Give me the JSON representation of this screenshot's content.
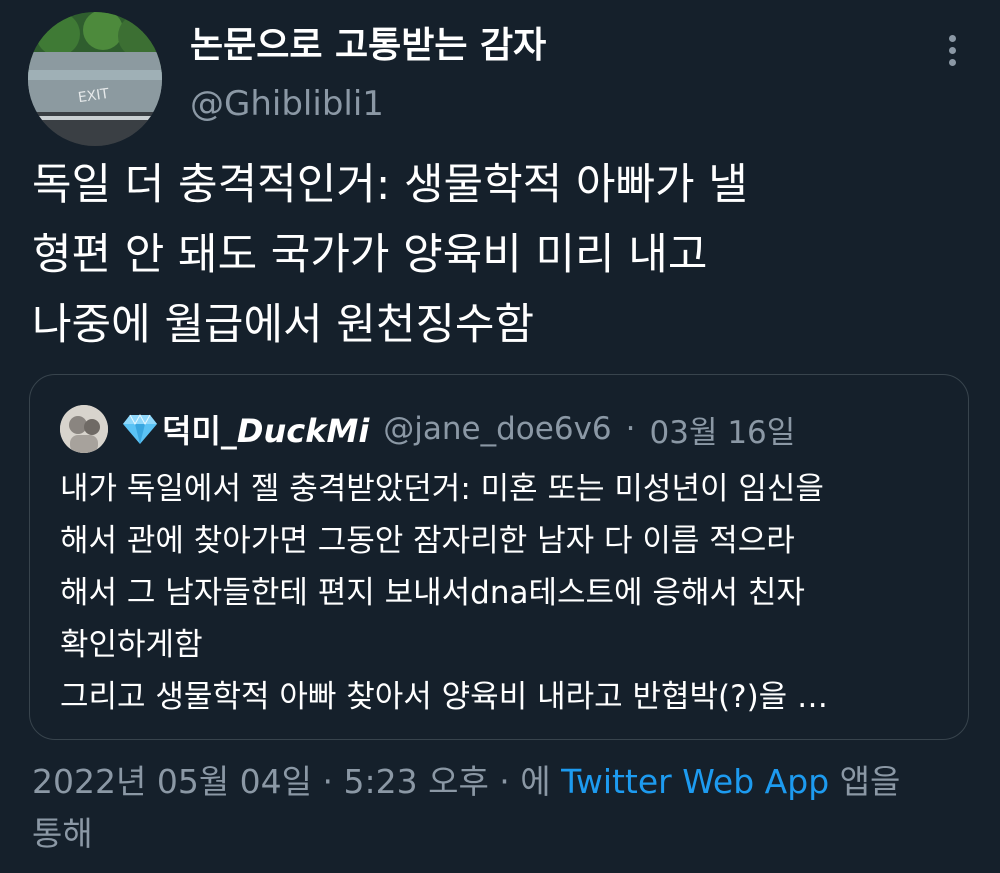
{
  "author": {
    "display_name": "논문으로 고통받는 감자",
    "handle": "@Ghiblibli1",
    "avatar_text": "EXIT"
  },
  "tweet": {
    "lines": [
      "독일 더 충격적인거: 생물학적 아빠가 낼",
      "형편 안 돼도 국가가 양육비 미리 내고",
      "나중에 월급에서 원천징수함"
    ]
  },
  "quoted": {
    "name_korean": "덕미_",
    "name_latin": "DuckMi",
    "handle": "@jane_doe6v6",
    "separator": "·",
    "date": "03월 16일",
    "lines": [
      "내가 독일에서 젤 충격받았던거: 미혼 또는 미성년이 임신을",
      "해서 관에 찾아가면 그동안 잠자리한 남자 다 이름 적으라",
      "해서 그 남자들한테 편지 보내서dna테스트에 응해서 친자",
      "확인하게함",
      "그리고 생물학적 아빠 찾아서 양육비 내라고 반협박(?)을 …"
    ]
  },
  "footer": {
    "timestamp": "2022년 05월 04일 · 5:23 오후 · 에 ",
    "source_link": "Twitter Web App",
    "suffix": " 앱을",
    "line2": "통해"
  },
  "colors": {
    "background": "#15202b",
    "secondary_text": "#8b98a5",
    "link": "#1d9bf0",
    "border": "#38444d"
  },
  "icons": {
    "more": "more-vertical-icon",
    "badge": "blue-diamond-icon"
  }
}
